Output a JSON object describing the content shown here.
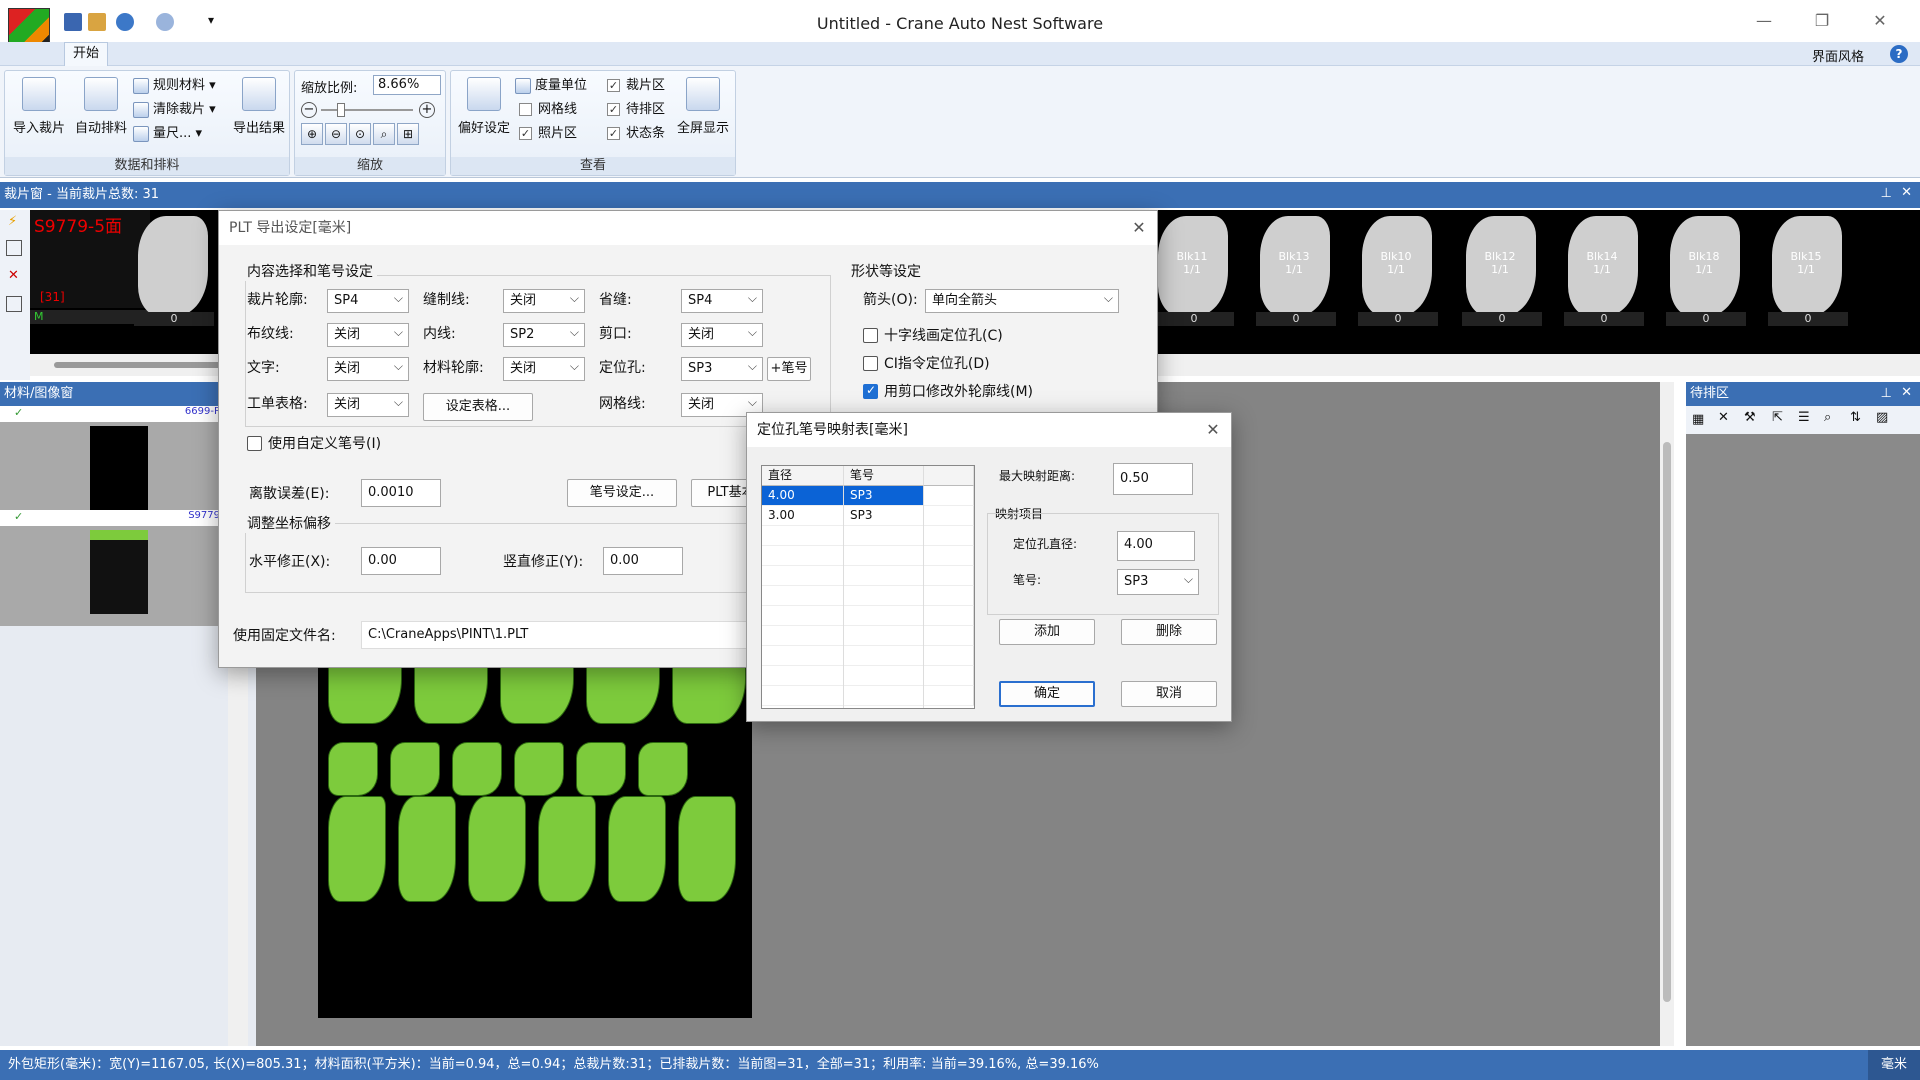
{
  "window": {
    "title": "Untitled - Crane Auto Nest Software"
  },
  "menu": {
    "tab_start": "开始",
    "theme": "界面风格"
  },
  "ribbon": {
    "btn_import": "导入裁片",
    "btn_autonest": "自动排料",
    "btn_rule_material": "规则材料",
    "btn_clear_pieces": "清除裁片",
    "btn_measure": "量尺...",
    "btn_export": "导出结果",
    "group_data": "数据和排料",
    "zoom_label": "缩放比例:",
    "zoom_value": "8.66%",
    "group_zoom": "缩放",
    "btn_prefs": "偏好设定",
    "chk_unit": "度量单位",
    "chk_grid": "网格线",
    "chk_photo": "照片区",
    "chk_cutzone": "裁片区",
    "chk_pending": "待排区",
    "chk_status": "状态条",
    "btn_fullscreen": "全屏显示",
    "group_view": "查看"
  },
  "cutwin": {
    "title": "裁片窗 - 当前裁片总数: 31",
    "current_piece": "S9779-5面",
    "count": "[31]",
    "m_label": "M",
    "pieces": [
      {
        "label": "",
        "num": "0"
      },
      {
        "label": "Blk11\n1/1",
        "num": "0"
      },
      {
        "label": "Blk13\n1/1",
        "num": "0"
      },
      {
        "label": "Blk10\n1/1",
        "num": "0"
      },
      {
        "label": "Blk12\n1/1",
        "num": "0"
      },
      {
        "label": "Blk14\n1/1",
        "num": "0"
      },
      {
        "label": "Blk18\n1/1",
        "num": "0"
      },
      {
        "label": "Blk15\n1/1",
        "num": "0"
      }
    ]
  },
  "matwin": {
    "title": "材料/图像窗",
    "item1": "6699-P",
    "item2": "S9779"
  },
  "pending": {
    "title": "待排区"
  },
  "status": {
    "text": "外包矩形(毫米)：宽(Y)=1167.05, 长(X)=805.31；材料面积(平方米)：当前=0.94，总=0.94；总裁片数:31；已排裁片数：当前图=31，全部=31；利用率: 当前=39.16%, 总=39.16%",
    "unit": "毫米"
  },
  "plt_dialog": {
    "title": "PLT 导出设定[毫米]",
    "sec_content": "内容选择和笔号设定",
    "lbl_cut_outline": "裁片轮廓:",
    "val_cut_outline": "SP4",
    "lbl_sew": "缝制线:",
    "val_sew": "关闭",
    "lbl_dart": "省缝:",
    "val_dart": "SP4",
    "lbl_grain": "布纹线:",
    "val_grain": "关闭",
    "lbl_inner": "内线:",
    "val_inner": "SP2",
    "lbl_notch": "剪口:",
    "val_notch": "关闭",
    "lbl_text": "文字:",
    "val_text": "关闭",
    "lbl_mat_outline": "材料轮廓:",
    "val_mat_outline": "关闭",
    "lbl_drill": "定位孔:",
    "val_drill": "SP3",
    "btn_pen_plus": "+笔号",
    "lbl_worksheet": "工单表格:",
    "val_worksheet": "关闭",
    "btn_set_table": "设定表格...",
    "lbl_gridline": "网格线:",
    "val_gridline": "关闭",
    "chk_custom_pen": "使用自定义笔号(I)",
    "lbl_tolerance": "离散误差(E):",
    "val_tolerance": "0.0010",
    "btn_pen_settings": "笔号设定...",
    "btn_plt_basic": "PLT基本",
    "sec_offset": "调整坐标偏移",
    "lbl_hfix": "水平修正(X):",
    "val_hfix": "0.00",
    "lbl_vfix": "竖直修正(Y):",
    "val_vfix": "0.00",
    "lbl_fixed_file": "使用固定文件名:",
    "val_fixed_file": "C:\\CraneApps\\PINT\\1.PLT",
    "sec_shape": "形状等设定",
    "lbl_arrow": "箭头(O):",
    "val_arrow": "单向全箭头",
    "chk_cross": "十字线画定位孔(C)",
    "chk_ci": "CI指令定位孔(D)",
    "chk_notch_outline": "用剪口修改外轮廓线(M)"
  },
  "map_dialog": {
    "title": "定位孔笔号映射表[毫米]",
    "col_diameter": "直径",
    "col_pen": "笔号",
    "rows": [
      {
        "diameter": "4.00",
        "pen": "SP3"
      },
      {
        "diameter": "3.00",
        "pen": "SP3"
      }
    ],
    "lbl_max_dist": "最大映射距离:",
    "val_max_dist": "0.50",
    "sec_item": "映射项目",
    "lbl_hole_diameter": "定位孔直径:",
    "val_hole_diameter": "4.00",
    "lbl_pen": "笔号:",
    "val_pen": "SP3",
    "btn_add": "添加",
    "btn_delete": "删除",
    "btn_ok": "确定",
    "btn_cancel": "取消"
  }
}
